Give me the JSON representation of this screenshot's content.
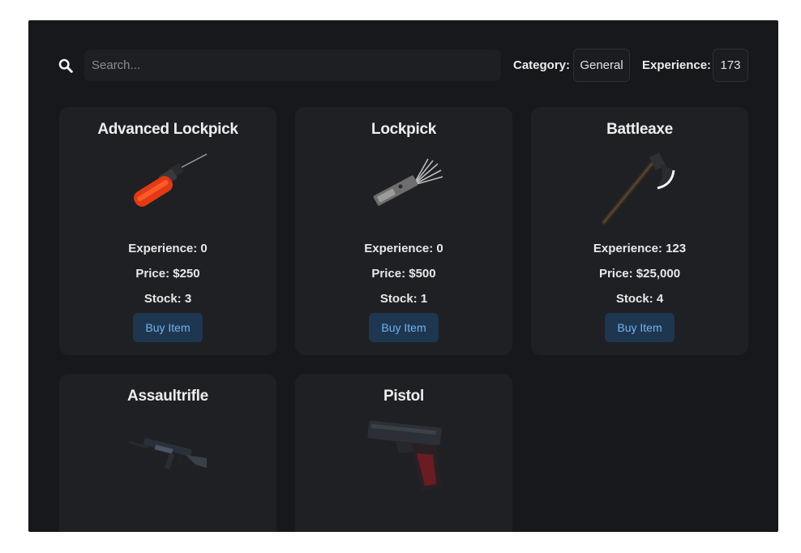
{
  "search": {
    "placeholder": "Search..."
  },
  "filters": {
    "category_label": "Category:",
    "category_value": "General",
    "experience_label": "Experience:",
    "experience_value": "173"
  },
  "items": [
    {
      "name": "Advanced Lockpick",
      "experience": "Experience: 0",
      "price": "Price: $250",
      "stock": "Stock: 3",
      "button": "Buy Item",
      "icon": "advanced-lockpick-icon"
    },
    {
      "name": "Lockpick",
      "experience": "Experience: 0",
      "price": "Price: $500",
      "stock": "Stock: 1",
      "button": "Buy Item",
      "icon": "lockpick-icon"
    },
    {
      "name": "Battleaxe",
      "experience": "Experience: 123",
      "price": "Price: $25,000",
      "stock": "Stock: 4",
      "button": "Buy Item",
      "icon": "battleaxe-icon"
    },
    {
      "name": "Assaultrifle",
      "icon": "assault-rifle-icon"
    },
    {
      "name": "Pistol",
      "icon": "pistol-icon"
    }
  ],
  "colors": {
    "panel_bg": "#17181b",
    "card_bg": "#1f2024",
    "button_bg": "#1f3650",
    "button_text": "#6fb5f0"
  }
}
